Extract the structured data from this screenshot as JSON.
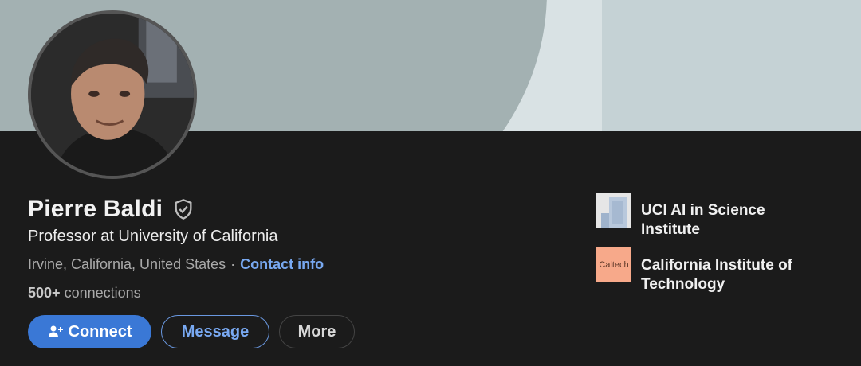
{
  "profile": {
    "name": "Pierre Baldi",
    "headline": "Professor at University of California",
    "location": "Irvine, California, United States",
    "separator": "·",
    "contact_info": "Contact info",
    "connections_count": "500+",
    "connections_label": "connections"
  },
  "actions": {
    "connect": "Connect",
    "message": "Message",
    "more": "More"
  },
  "organizations": [
    {
      "name": "UCI AI in Science Institute",
      "logo": ""
    },
    {
      "name": "California Institute of Technology",
      "logo": "Caltech"
    }
  ],
  "colors": {
    "primary": "#3a78d6",
    "link": "#78a8f0",
    "background": "#1b1b1b",
    "banner": "#c5d2d5"
  },
  "icons": {
    "verified": "shield-check-icon",
    "connect": "add-user-icon"
  }
}
